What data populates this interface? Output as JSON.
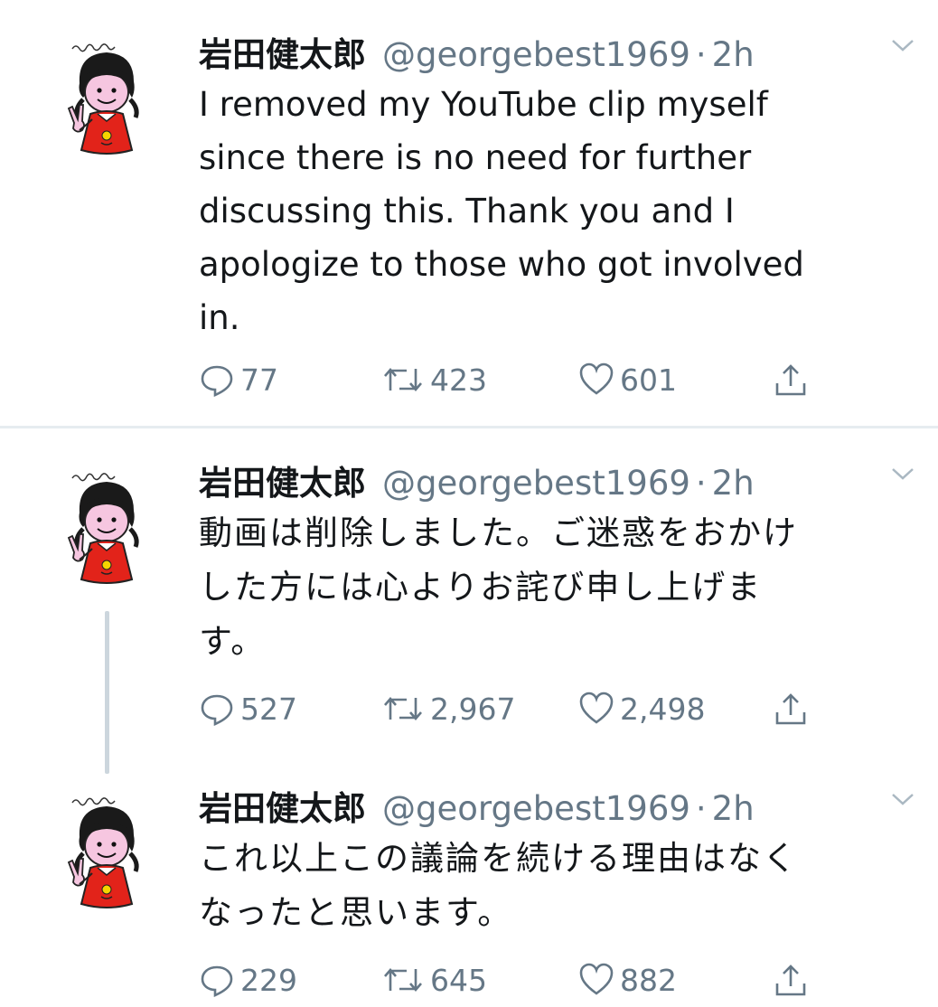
{
  "tweets": [
    {
      "author": "岩田健太郎",
      "handle": "@georgebest1969",
      "separator": "·",
      "time": "2h",
      "text": "I removed my YouTube clip myself\nsince there is no need for further\ndiscussing this. Thank you and I\napologize to those who got involved\nin.",
      "replies": "77",
      "retweets": "423",
      "likes": "601"
    },
    {
      "author": "岩田健太郎",
      "handle": "@georgebest1969",
      "separator": "·",
      "time": "2h",
      "text": "動画は削除しました。ご迷惑をおかけ\nした方には心よりお詫び申し上げま\nす。",
      "replies": "527",
      "retweets": "2,967",
      "likes": "2,498"
    },
    {
      "author": "岩田健太郎",
      "handle": "@georgebest1969",
      "separator": "·",
      "time": "2h",
      "text": "これ以上この議論を続ける理由はなく\nなったと思います。",
      "replies": "229",
      "retweets": "645",
      "likes": "882"
    }
  ],
  "icons": {
    "reply": "reply-icon",
    "retweet": "retweet-icon",
    "like": "heart-icon",
    "share": "share-icon",
    "caret": "chevron-down-icon",
    "avatar": "cartoon-girl-avatar"
  },
  "colors": {
    "text": "#14171a",
    "muted": "#657786",
    "divider": "#e6ecf0",
    "thread_line": "#ccd6dd",
    "avatar_dress": "#e2231a"
  }
}
